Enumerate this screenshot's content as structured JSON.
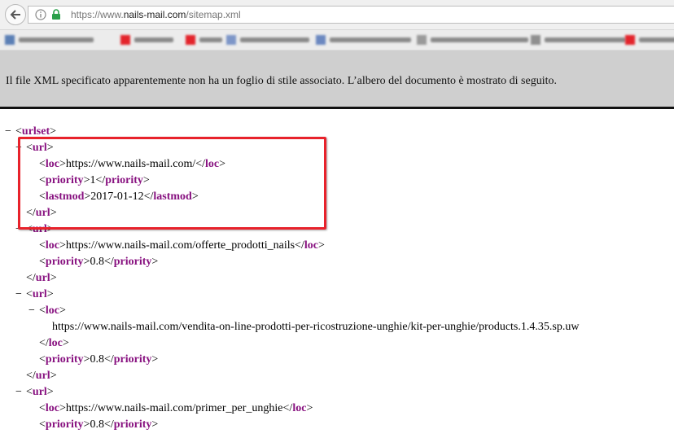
{
  "browser": {
    "url_prefix": "https://www.",
    "url_host": "nails-mail.com",
    "url_path": "/sitemap.xml"
  },
  "notice": {
    "text": "Il file XML specificato apparentemente non ha un foglio di stile associato. L’albero del documento è mostrato di seguito."
  },
  "xml": {
    "toggle_symbol": "−",
    "lines": [
      {
        "tag": "urlset",
        "open": true
      },
      {
        "tag": "url",
        "open": true
      },
      {
        "tag": "loc",
        "value": "https://www.nails-mail.com/"
      },
      {
        "tag": "priority",
        "value": "1"
      },
      {
        "tag": "lastmod",
        "value": "2017-01-12"
      },
      {
        "tag": "url",
        "close": true
      },
      {
        "tag": "url",
        "open": true
      },
      {
        "tag": "loc",
        "value": "https://www.nails-mail.com/offerte_prodotti_nails"
      },
      {
        "tag": "priority",
        "value": "0.8"
      },
      {
        "tag": "url",
        "close": true
      },
      {
        "tag": "url",
        "open": true
      },
      {
        "tag": "loc",
        "open": true
      },
      {
        "text": "https://www.nails-mail.com/vendita-on-line-prodotti-per-ricostruzione-unghie/kit-per-unghie/products.1.4.35.sp.uw"
      },
      {
        "tag": "loc",
        "close": true
      },
      {
        "tag": "priority",
        "value": "0.8"
      },
      {
        "tag": "url",
        "close": true
      },
      {
        "tag": "url",
        "open": true
      },
      {
        "tag": "loc",
        "value": "https://www.nails-mail.com/primer_per_unghie"
      },
      {
        "tag": "priority",
        "value": "0.8"
      }
    ]
  }
}
